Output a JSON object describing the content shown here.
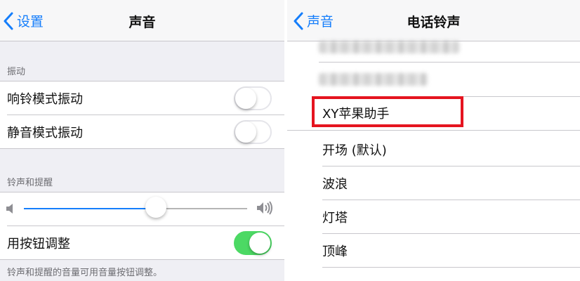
{
  "left": {
    "nav": {
      "back_label": "设置",
      "title": "声音"
    },
    "vibration": {
      "header": "振动",
      "ring_vibrate": {
        "label": "响铃模式振动",
        "on": false
      },
      "silent_vibrate": {
        "label": "静音模式振动",
        "on": false
      }
    },
    "ringer": {
      "header": "铃声和提醒",
      "volume_level": 0.59,
      "change_with_buttons": {
        "label": "用按钮调整",
        "on": true
      },
      "footer": "铃声和提醒的音量可用音量按钮调整。"
    }
  },
  "right": {
    "nav": {
      "back_label": "声音",
      "title": "电话铃声"
    },
    "tones": [
      {
        "label": "XY苹果助手",
        "highlighted": true
      },
      {
        "label": "开场 (默认)"
      },
      {
        "label": "波浪"
      },
      {
        "label": "灯塔"
      },
      {
        "label": "顶峰"
      }
    ]
  },
  "colors": {
    "accent": "#157efb",
    "switch_on": "#4cd964",
    "highlight_box": "#e5141f",
    "grouped_background": "#efeff4"
  }
}
